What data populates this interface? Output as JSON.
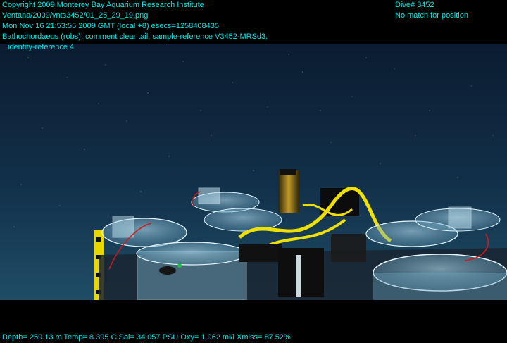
{
  "overlay": {
    "copyright": "Copyright 2009 Monterey Bay Aquarium Research Institute",
    "file_path": "Ventana/2009/vnts3452/01_25_29_19.png",
    "timestamp": "Mon Nov 16 21:53:55 2009 GMT (local +8)  esecs=1258408435",
    "annotation_line1": "Bathochordaeus (robs): comment clear tail, sample-reference V3452-MRSd3,",
    "annotation_line2": "identity-reference 4",
    "dive": "Dive# 3452",
    "position": "No match for position",
    "footer": "Depth= 259.13 m  Temp= 8.395 C  Sal= 34.057 PSU  Oxy= 1.962 ml/l  Xmiss= 87.52%"
  },
  "colors": {
    "overlay_text": "#00e5e5",
    "water_top": "#0a1f33",
    "water_bottom": "#1d4a63",
    "hardware_yellow": "#e8d800",
    "letterbox": "#000000"
  }
}
